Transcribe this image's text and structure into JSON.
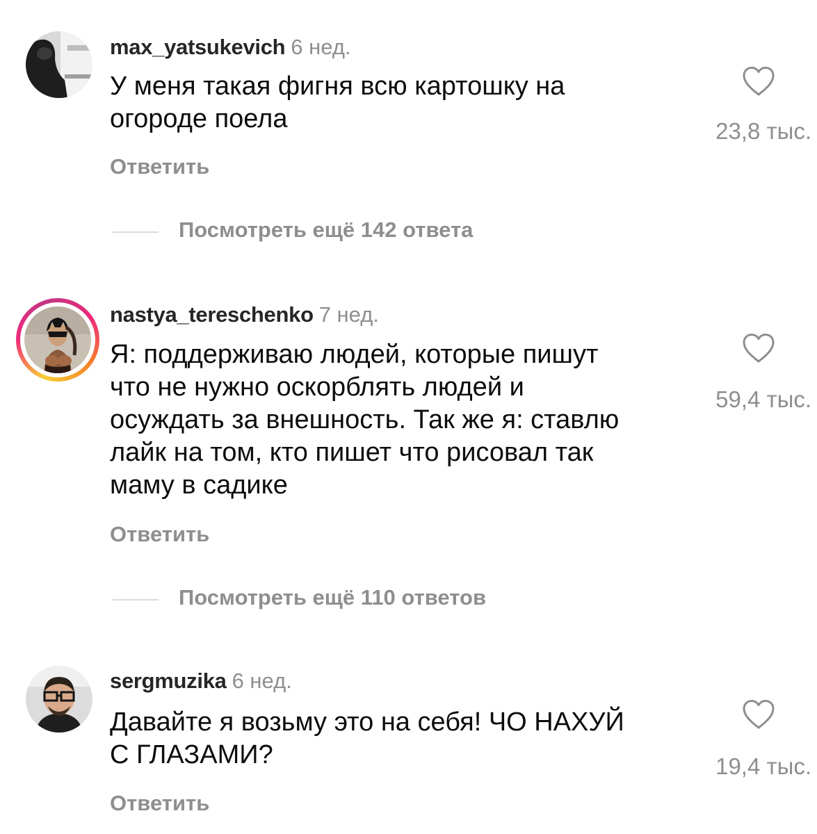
{
  "comments": [
    {
      "username": "max_yatsukevich",
      "time": "6 нед.",
      "text_lines": [
        "У меня такая фигня всю картошку на",
        "огороде поела"
      ],
      "likes": "23,8 тыс.",
      "reply": "Ответить",
      "view_more": "Посмотреть ещё 142 ответа",
      "has_story": false
    },
    {
      "username": "nastya_tereschenko",
      "time": "7 нед.",
      "text_lines": [
        "Я: поддерживаю людей, которые пишут",
        "что не нужно оскорблять людей и",
        "осуждать за внешность.  Так же я: ставлю",
        "лайк на том, кто пишет что рисовал так",
        "маму в садике"
      ],
      "likes": "59,4 тыс.",
      "reply": "Ответить",
      "view_more": "Посмотреть ещё 110 ответов",
      "has_story": true
    },
    {
      "username": "sergmuzika",
      "time": "6 нед.",
      "text_lines": [
        "Давайте я возьму это на себя! ЧО НАХУЙ",
        "С ГЛАЗАМИ?"
      ],
      "likes": "19,4 тыс.",
      "reply": "Ответить",
      "has_story": false
    }
  ],
  "icons": {
    "like": "heart-outline-icon",
    "avatar": "user-avatar"
  },
  "colors": {
    "text": "#0d0d0d",
    "username": "#262626",
    "secondary": "#8e8e8e",
    "divider": "#dbdbdb"
  }
}
